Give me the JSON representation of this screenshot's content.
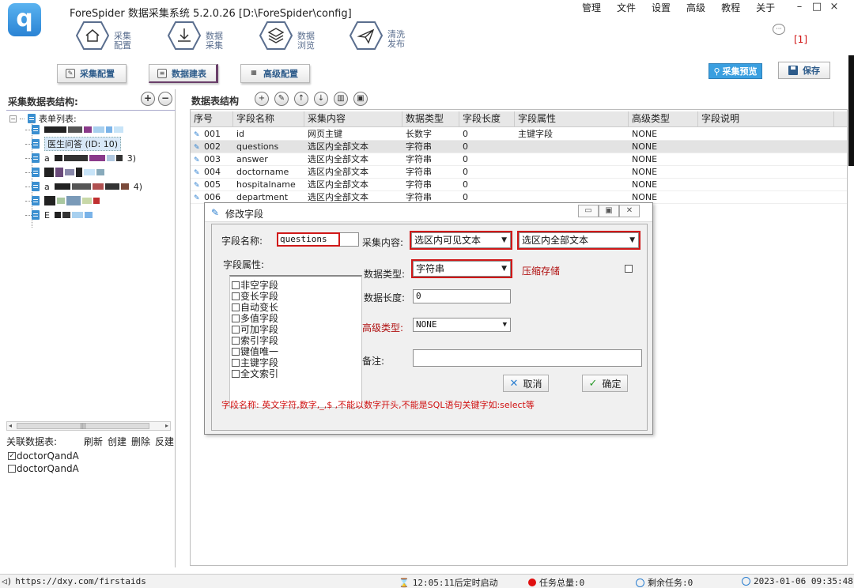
{
  "window": {
    "title": "ForeSpider 数据采集系统  5.2.0.26  [D:\\ForeSpider\\config]",
    "logo_glyph": "q",
    "menu": [
      "管理",
      "文件",
      "设置",
      "高级",
      "教程",
      "关于"
    ],
    "controls": [
      "–",
      "□",
      "×"
    ],
    "feedback_count": "[1]"
  },
  "nav_tabs": [
    {
      "line1": "采集",
      "line2": "配置",
      "icon": "home-icon"
    },
    {
      "line1": "数据",
      "line2": "采集",
      "icon": "download-icon"
    },
    {
      "line1": "数据",
      "line2": "浏览",
      "icon": "layers-icon"
    },
    {
      "line1": "清洗",
      "line2": "发布",
      "icon": "send-icon"
    }
  ],
  "subtabs": [
    "采集配置",
    "数据建表",
    "高级配置"
  ],
  "actions": {
    "preview": "采集预览",
    "save": "保存"
  },
  "left_panel": {
    "title": "采集数据表结构:",
    "tree_root": "表单列表:",
    "tree_items": [
      {
        "label": "",
        "redacted": true
      },
      {
        "label": "医生问答 (ID: 10)",
        "selected": true
      },
      {
        "label": "a",
        "redacted": true,
        "suffix": "3)"
      },
      {
        "label": "",
        "redacted": true
      },
      {
        "label": "a",
        "redacted": true,
        "suffix": "4)"
      },
      {
        "label": "",
        "redacted": true
      },
      {
        "label": "E",
        "redacted": true
      }
    ],
    "related_title": "关联数据表:",
    "related_actions": [
      "刷新",
      "创建",
      "删除",
      "反建"
    ],
    "related_items": [
      {
        "label": "doctorQandA",
        "checked": true
      },
      {
        "label": "doctorQandA",
        "checked": false
      }
    ]
  },
  "main": {
    "title": "数据表结构",
    "columns": [
      "序号",
      "字段名称",
      "采集内容",
      "数据类型",
      "字段长度",
      "字段属性",
      "高级类型",
      "字段说明"
    ],
    "rows": [
      {
        "no": "001",
        "name": "id",
        "content": "网页主键",
        "type": "长数字",
        "length": "0",
        "attr": "主键字段",
        "adv": "NONE",
        "desc": ""
      },
      {
        "no": "002",
        "name": "questions",
        "content": "选区内全部文本",
        "type": "字符串",
        "length": "0",
        "attr": "",
        "adv": "NONE",
        "desc": ""
      },
      {
        "no": "003",
        "name": "answer",
        "content": "选区内全部文本",
        "type": "字符串",
        "length": "0",
        "attr": "",
        "adv": "NONE",
        "desc": ""
      },
      {
        "no": "004",
        "name": "doctorname",
        "content": "选区内全部文本",
        "type": "字符串",
        "length": "0",
        "attr": "",
        "adv": "NONE",
        "desc": ""
      },
      {
        "no": "005",
        "name": "hospitalname",
        "content": "选区内全部文本",
        "type": "字符串",
        "length": "0",
        "attr": "",
        "adv": "NONE",
        "desc": ""
      },
      {
        "no": "006",
        "name": "department",
        "content": "选区内全部文本",
        "type": "字符串",
        "length": "0",
        "attr": "",
        "adv": "NONE",
        "desc": ""
      }
    ]
  },
  "dialog": {
    "title": "修改字段",
    "field_name_label": "字段名称:",
    "field_name_value": "questions",
    "collect_label": "采集内容:",
    "collect_value_1": "选区内可见文本",
    "collect_value_2": "选区内全部文本",
    "props_label": "字段属性:",
    "props": [
      "非空字段",
      "变长字段",
      "自动变长",
      "多值字段",
      "可加字段",
      "索引字段",
      "键值唯一",
      "主键字段",
      "全文索引"
    ],
    "type_label": "数据类型:",
    "type_value": "字符串",
    "compress_label": "压缩存储",
    "length_label": "数据长度:",
    "length_value": "0",
    "adv_label": "高级类型:",
    "adv_value": "NONE",
    "note_label": "备注:",
    "note_value": "",
    "cancel": "取消",
    "ok": "确定",
    "hint": "字段名称: 英文字符,数字,_,$ ,不能以数字开头,不能是SQL语句关键字如:select等"
  },
  "status": {
    "url": "https://dxy.com/firstaids",
    "schedule": "12:05:11后定时启动",
    "total": "任务总量:0",
    "remaining": "剩余任务:0",
    "datetime": "2023-01-06 09:35:48"
  },
  "colors": {
    "accent": "#2c7fd0",
    "highlight_red": "#d01818",
    "hint_red": "#d01010"
  }
}
